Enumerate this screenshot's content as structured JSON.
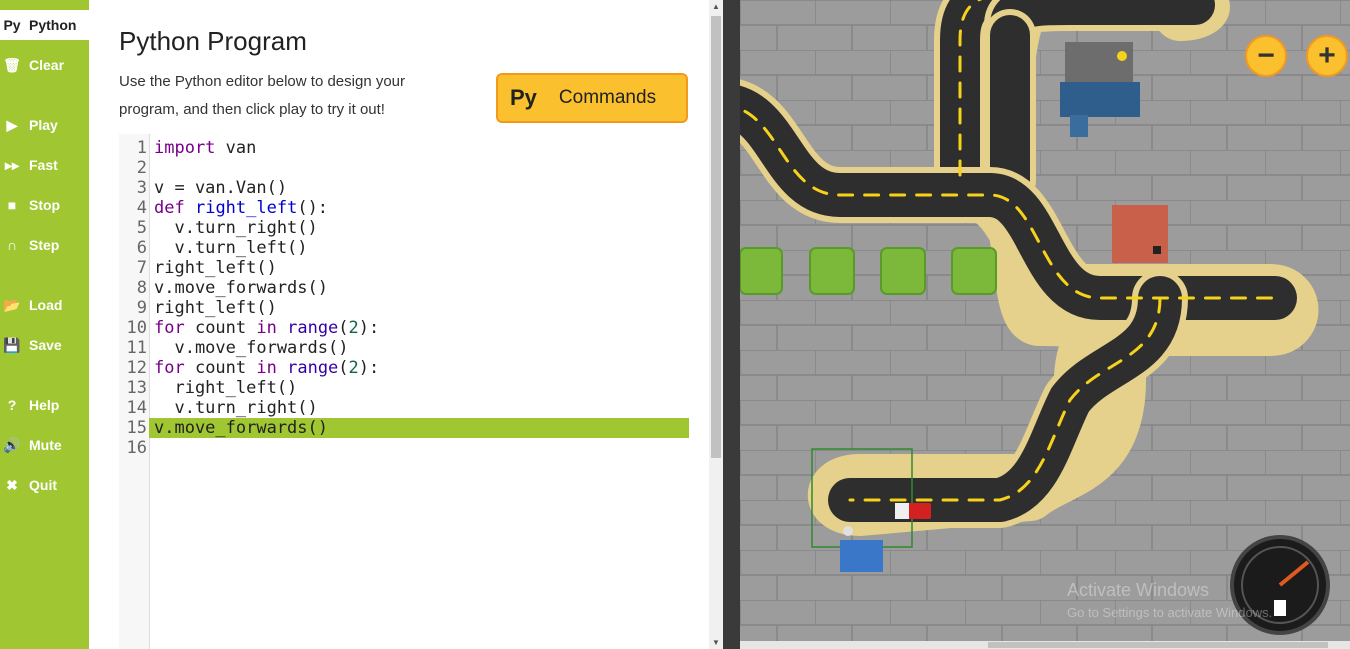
{
  "sidebar": {
    "items": [
      {
        "icon": "python-logo-icon",
        "glyph": "Py",
        "label": "Python",
        "active": true
      },
      {
        "icon": "trash-icon",
        "glyph": "🗑",
        "label": "Clear"
      },
      {
        "icon": "play-icon",
        "glyph": "▶",
        "label": "Play"
      },
      {
        "icon": "fast-forward-icon",
        "glyph": "▸▸",
        "label": "Fast"
      },
      {
        "icon": "stop-icon",
        "glyph": "■",
        "label": "Stop"
      },
      {
        "icon": "step-icon",
        "glyph": "∩",
        "label": "Step"
      },
      {
        "icon": "folder-icon",
        "glyph": "📂",
        "label": "Load"
      },
      {
        "icon": "save-icon",
        "glyph": "💾",
        "label": "Save"
      },
      {
        "icon": "help-icon",
        "glyph": "?",
        "label": "Help"
      },
      {
        "icon": "speaker-icon",
        "glyph": "🔊",
        "label": "Mute"
      },
      {
        "icon": "close-icon",
        "glyph": "✖",
        "label": "Quit"
      }
    ]
  },
  "panel": {
    "title": "Python Program",
    "description": "Use the Python editor below to design your program, and then click play to try it out!",
    "commands_button": {
      "logo": "Py",
      "label": "Commands"
    }
  },
  "editor": {
    "highlighted_line": 15,
    "lines": [
      "import van",
      "",
      "v = van.Van()",
      "def right_left():",
      "  v.turn_right()",
      "  v.turn_left()",
      "right_left()",
      "v.move_forwards()",
      "right_left()",
      "for count in range(2):",
      "  v.move_forwards()",
      "for count in range(2):",
      "  right_left()",
      "  v.turn_right()",
      "v.move_forwards()",
      ""
    ]
  },
  "map": {
    "zoom_out_label": "−",
    "zoom_in_label": "+",
    "watermark_title": "Activate Windows",
    "watermark_text": "Go to Settings to activate Windows.",
    "colors": {
      "road": "#2b2b2b",
      "curb": "#e8d79a",
      "lane": "#f7d21a",
      "ground": "#9a9a9a",
      "tree": "#7cb83a",
      "van": "#d32020"
    }
  }
}
